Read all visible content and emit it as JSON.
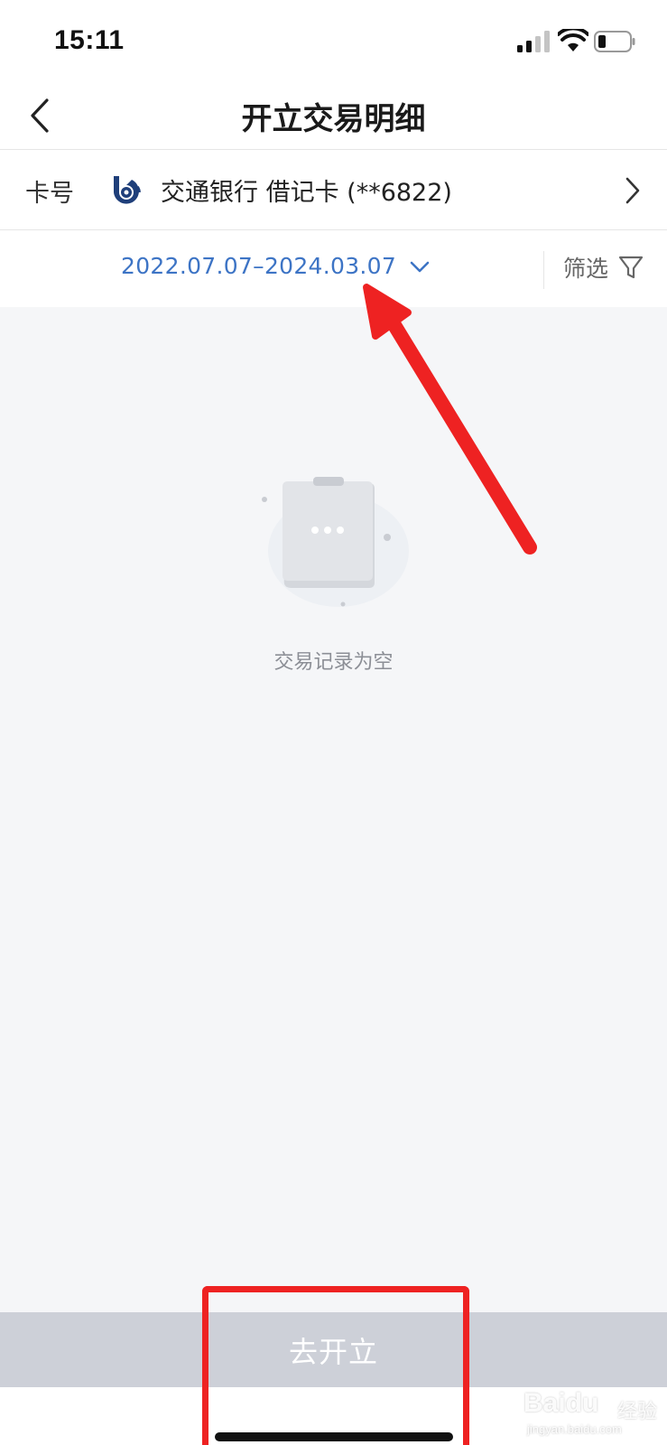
{
  "status_bar": {
    "time": "15:11",
    "icons": [
      "signal-icon",
      "wifi-icon",
      "battery-icon"
    ]
  },
  "nav": {
    "back_icon": "chevron-left-icon",
    "title": "开立交易明细"
  },
  "card": {
    "label": "卡号",
    "bank_logo_icon": "bank-logo-icon",
    "text": "交通银行 借记卡 (**6822)",
    "arrow_icon": "chevron-right-icon"
  },
  "filter": {
    "date_range": "2022.07.07–2024.03.07",
    "date_icon": "chevron-down-icon",
    "filter_label": "筛选",
    "filter_icon": "funnel-icon"
  },
  "empty_state": {
    "icon": "empty-document-icon",
    "text": "交易记录为空"
  },
  "bottom": {
    "button_label": "去开立"
  },
  "watermark": {
    "brand": "Baidu",
    "sub": "经验",
    "domain": "jingyan.baidu.com"
  },
  "colors": {
    "accent": "#3d74c5",
    "annotation": "#ee2222",
    "content_bg": "#f5f6f8",
    "button_disabled": "#cdd0d8"
  }
}
